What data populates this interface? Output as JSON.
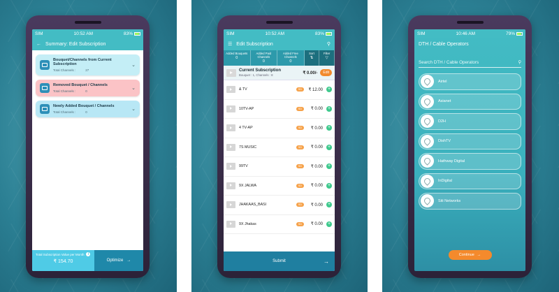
{
  "panel1": {
    "status": {
      "sim": "SIM",
      "time": "10:52 AM",
      "battery": "83%"
    },
    "header": {
      "title": "Summary: Edit Subscription"
    },
    "cards": [
      {
        "title": "Bouquet/Channels from Current Subscription",
        "channels_label": "Total Channels :",
        "channels_count": "27"
      },
      {
        "title": "Removed Bouquet / Channels",
        "channels_label": "Total Channels :",
        "channels_count": "0"
      },
      {
        "title": "Newly Added Bouquet / Channels",
        "channels_label": "Total Channels :",
        "channels_count": "0"
      }
    ],
    "footer": {
      "label": "Total Subscription Value per Month",
      "value": "₹ 154.70",
      "optimize_label": "Optimize"
    }
  },
  "panel2": {
    "status": {
      "sim": "SIM",
      "time": "10:52 AM",
      "battery": "83%"
    },
    "header": {
      "title": "Edit Subscription"
    },
    "tabs": [
      {
        "label": "Added Bouquets",
        "count": "0"
      },
      {
        "label": "Added Paid Channels",
        "count": "0"
      },
      {
        "label": "Added Free Channels",
        "count": "0"
      }
    ],
    "sort_label": "Sort",
    "filter_label": "Filter",
    "current": {
      "title": "Current Subscription",
      "subtitle": "Bouquet : 1, Channels : 8",
      "price": "₹ 0.00/-",
      "edit_label": "Edit"
    },
    "channels": [
      {
        "name": "& TV",
        "badge": "SD",
        "price": "₹ 12.00"
      },
      {
        "name": "10TV-AP",
        "badge": "SD",
        "price": "₹ 0.00"
      },
      {
        "name": "4 TV-AP",
        "badge": "SD",
        "price": "₹ 0.00"
      },
      {
        "name": "7S MUSIC",
        "badge": "SD",
        "price": "₹ 0.00"
      },
      {
        "name": "99TV",
        "badge": "SD",
        "price": "₹ 0.00"
      },
      {
        "name": "9X JALWA",
        "badge": "SD",
        "price": "₹ 0.00"
      },
      {
        "name": "JHAKAAS_BASI",
        "badge": "SD",
        "price": "₹ 0.00"
      },
      {
        "name": "9X Jhakas",
        "badge": "SD",
        "price": "₹ 0.00"
      }
    ],
    "submit_label": "Submit"
  },
  "panel3": {
    "status": {
      "sim": "SIM",
      "time": "10:46 AM",
      "battery": "79%"
    },
    "header": {
      "title": "DTH  / Cable Operators"
    },
    "search": {
      "placeholder": "Search DTH / Cable Operators"
    },
    "operators": [
      "Airtel",
      "Asianet",
      "D2H",
      "DishTV",
      "Hathway Digital",
      "InDigital",
      "Siti Networks"
    ],
    "continue_label": "Continue"
  }
}
